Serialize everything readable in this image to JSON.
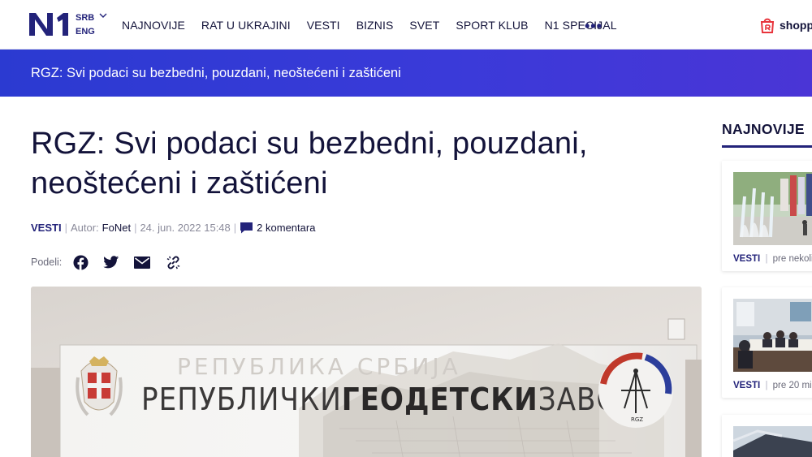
{
  "header": {
    "logo_text": "N1",
    "languages": [
      "SRB",
      "ENG"
    ],
    "nav_items": [
      "NAJNOVIJE",
      "RAT U UKRAJINI",
      "VESTI",
      "BIZNIS",
      "SVET",
      "SPORT KLUB",
      "N1 SPECIJAL"
    ],
    "more_icon": "ellipsis-icon",
    "shop_label": "shopp"
  },
  "banner": {
    "title": "RGZ: Svi podaci su bezbedni, pouzdani, neoštećeni i zaštićeni"
  },
  "article": {
    "headline": "RGZ: Svi podaci su bezbedni, pouzdani, neoštećeni i zaštićeni",
    "category": "VESTI",
    "author_label": "Autor:",
    "author": "FoNet",
    "date": "24. jun. 2022 15:48",
    "comments": "2 komentara",
    "share_label": "Podeli:",
    "share_icons": [
      "facebook-icon",
      "twitter-icon",
      "email-icon",
      "link-icon"
    ],
    "hero_sign": {
      "top_text": "РЕПУБЛИКА СРБИЈА",
      "word1": "РЕПУБЛИЧКИ",
      "word2": "ГЕОДЕТСКИ",
      "word3": "ЗАВОД",
      "emblem_text": "RGZ"
    }
  },
  "sidebar": {
    "title": "NAJNOVIJE",
    "cards": [
      {
        "category": "VESTI",
        "time": "pre nekoli"
      },
      {
        "category": "VESTI",
        "time": "pre 20 mi"
      },
      {
        "category": "",
        "time": ""
      }
    ]
  },
  "colors": {
    "brand": "#23237a",
    "banner_start": "#2b3ad1",
    "banner_end": "#4a35d6",
    "shop_red": "#e8343c"
  }
}
